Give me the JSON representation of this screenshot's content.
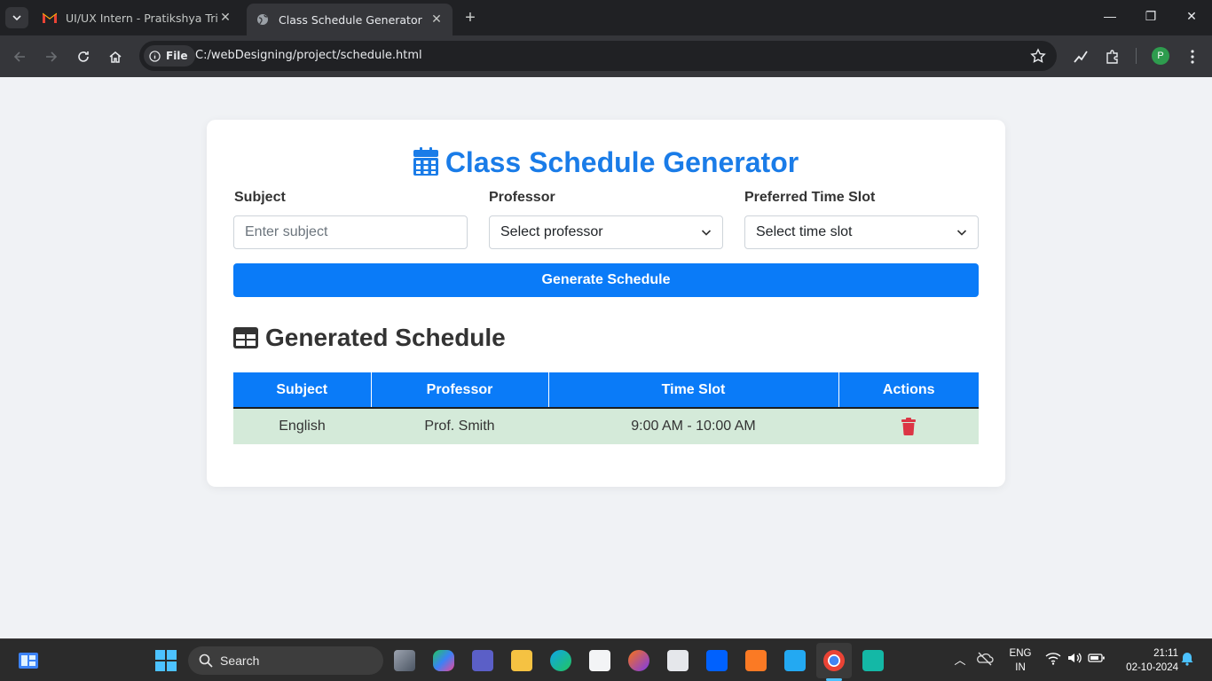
{
  "browser": {
    "tabs": [
      {
        "title": "UI/UX Intern - Pratikshya Tripathy"
      },
      {
        "title": "Class Schedule Generator"
      }
    ],
    "address": {
      "chip_label": "File",
      "url": "C:/webDesigning/project/schedule.html"
    },
    "profile_initial": "P"
  },
  "page": {
    "title": "Class Schedule Generator",
    "form": {
      "subject_label": "Subject",
      "subject_placeholder": "Enter subject",
      "professor_label": "Professor",
      "professor_value": "Select professor",
      "time_label": "Preferred Time Slot",
      "time_value": "Select time slot",
      "generate_button": "Generate Schedule"
    },
    "schedule": {
      "heading": "Generated Schedule",
      "columns": [
        "Subject",
        "Professor",
        "Time Slot",
        "Actions"
      ],
      "rows": [
        {
          "subject": "English",
          "professor": "Prof. Smith",
          "time_slot": "9:00 AM - 10:00 AM"
        }
      ]
    }
  },
  "taskbar": {
    "search_label": "Search",
    "lang_top": "ENG",
    "lang_bottom": "IN",
    "time": "21:11",
    "date": "02-10-2024"
  },
  "colors": {
    "accent": "#0a7bf8",
    "row_bg": "#d4ead9",
    "delete": "#dc3545"
  }
}
